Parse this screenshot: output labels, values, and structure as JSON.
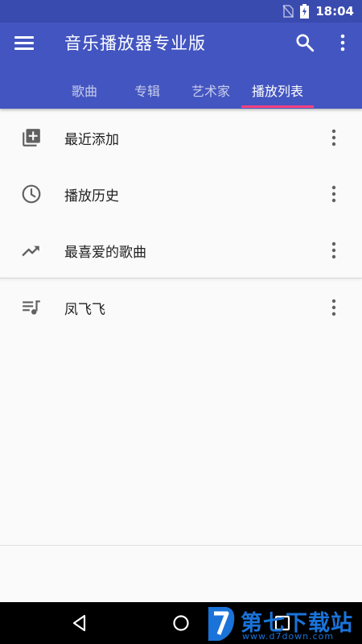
{
  "status_bar": {
    "time": "18:04"
  },
  "app_bar": {
    "title": "音乐播放器专业版"
  },
  "tabs": [
    {
      "label": "歌曲",
      "active": false
    },
    {
      "label": "专辑",
      "active": false
    },
    {
      "label": "艺术家",
      "active": false
    },
    {
      "label": "播放列表",
      "active": true
    }
  ],
  "playlists": [
    {
      "label": "最近添加",
      "icon": "library-add-icon"
    },
    {
      "label": "播放历史",
      "icon": "clock-icon"
    },
    {
      "label": "最喜爱的歌曲",
      "icon": "trending-up-icon"
    },
    {
      "label": "凤飞飞",
      "icon": "queue-music-icon"
    }
  ],
  "watermark": {
    "brand": "第七下载站",
    "url": "www.d7down.com"
  },
  "colors": {
    "app_bar": "#4355c0",
    "status_bar": "#3a4bb0",
    "tab_indicator": "#ff4081"
  }
}
